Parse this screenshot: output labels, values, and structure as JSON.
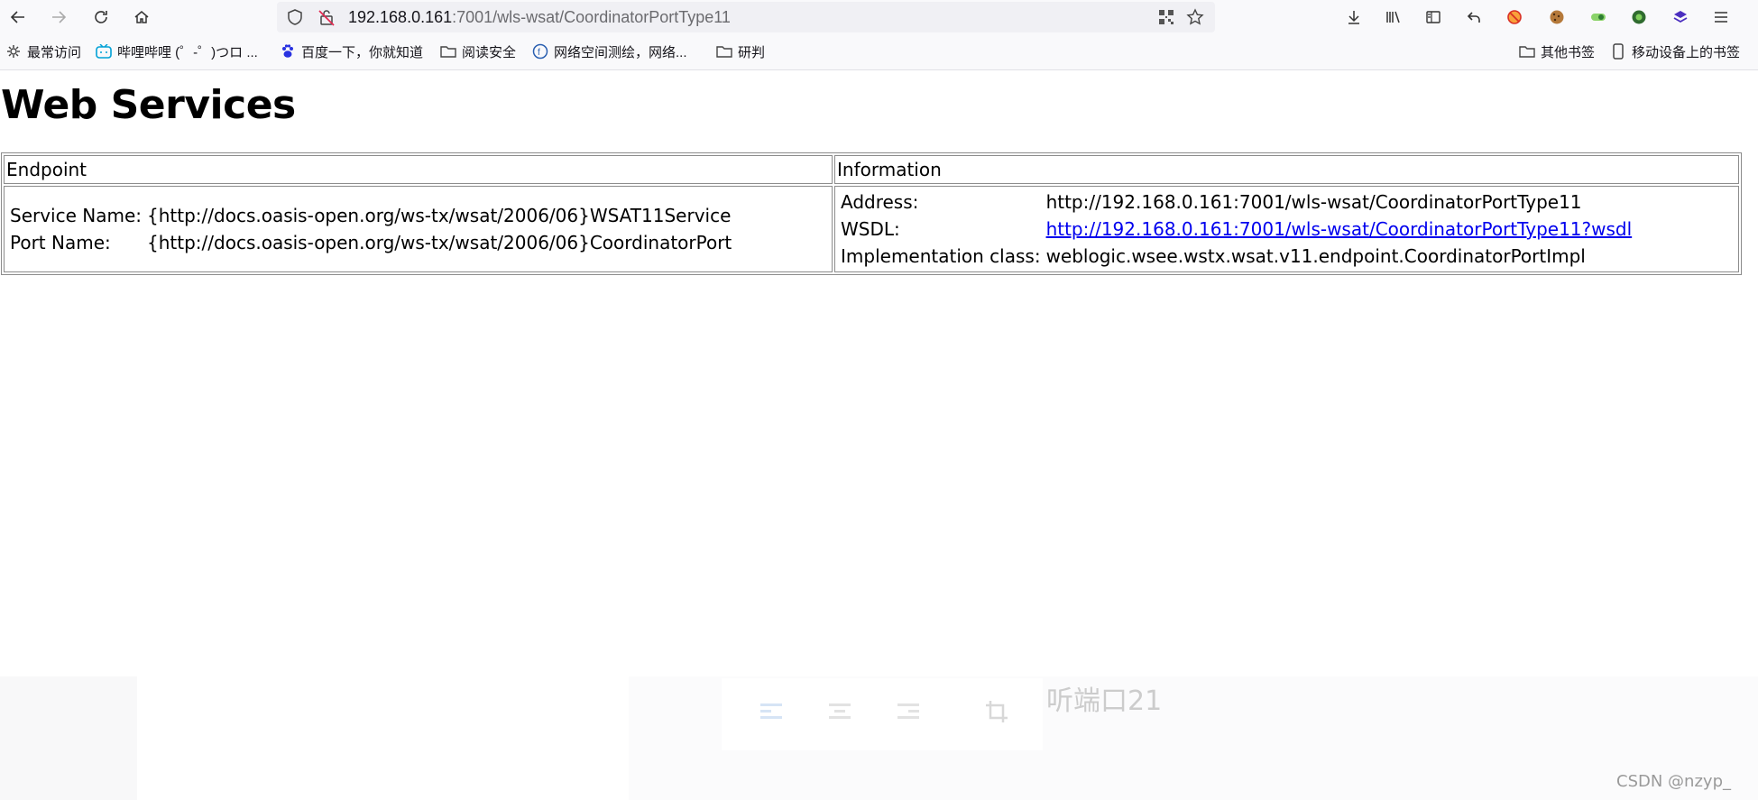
{
  "browser": {
    "url_host": "192.168.0.161",
    "url_path": ":7001/wls-wsat/CoordinatorPortType11",
    "bookmarks_left": [
      {
        "label": "最常访问",
        "icon": "gear-icon"
      },
      {
        "label": "哔哩哔哩 (゜-゜)つロ ...",
        "icon": "bilibili-icon"
      },
      {
        "label": "百度一下，你就知道",
        "icon": "baidu-paw-icon"
      },
      {
        "label": "阅读安全",
        "icon": "folder-icon"
      },
      {
        "label": "网络空间测绘，网络...",
        "icon": "fofa-icon"
      },
      {
        "label": "研判",
        "icon": "folder-icon"
      }
    ],
    "bookmarks_right": [
      {
        "label": "其他书签",
        "icon": "folder-icon"
      },
      {
        "label": "移动设备上的书签",
        "icon": "mobile-icon"
      }
    ]
  },
  "page": {
    "title": "Web Services",
    "table": {
      "header_endpoint": "Endpoint",
      "header_information": "Information",
      "endpoint": {
        "service_label": "Service Name:",
        "service_value": "{http://docs.oasis-open.org/ws-tx/wsat/2006/06}WSAT11Service",
        "port_label": "Port Name:",
        "port_value": "{http://docs.oasis-open.org/ws-tx/wsat/2006/06}CoordinatorPort"
      },
      "information": {
        "address_label": "Address:",
        "address_value": "http://192.168.0.161:7001/wls-wsat/CoordinatorPortType11",
        "wsdl_label": "WSDL:",
        "wsdl_value": "http://192.168.0.161:7001/wls-wsat/CoordinatorPortType11?wsdl",
        "impl_label": "Implementation class:",
        "impl_value": "weblogic.wsee.wstx.wsat.v11.endpoint.CoordinatorPortImpl"
      }
    }
  },
  "overlay": {
    "ghost_text": "听端口21",
    "watermark": "CSDN @nzyp_"
  },
  "colors": {
    "link": "#0000ee",
    "toolbar_bg": "#f9f9fb",
    "urlbar_bg": "#f0f0f4"
  }
}
